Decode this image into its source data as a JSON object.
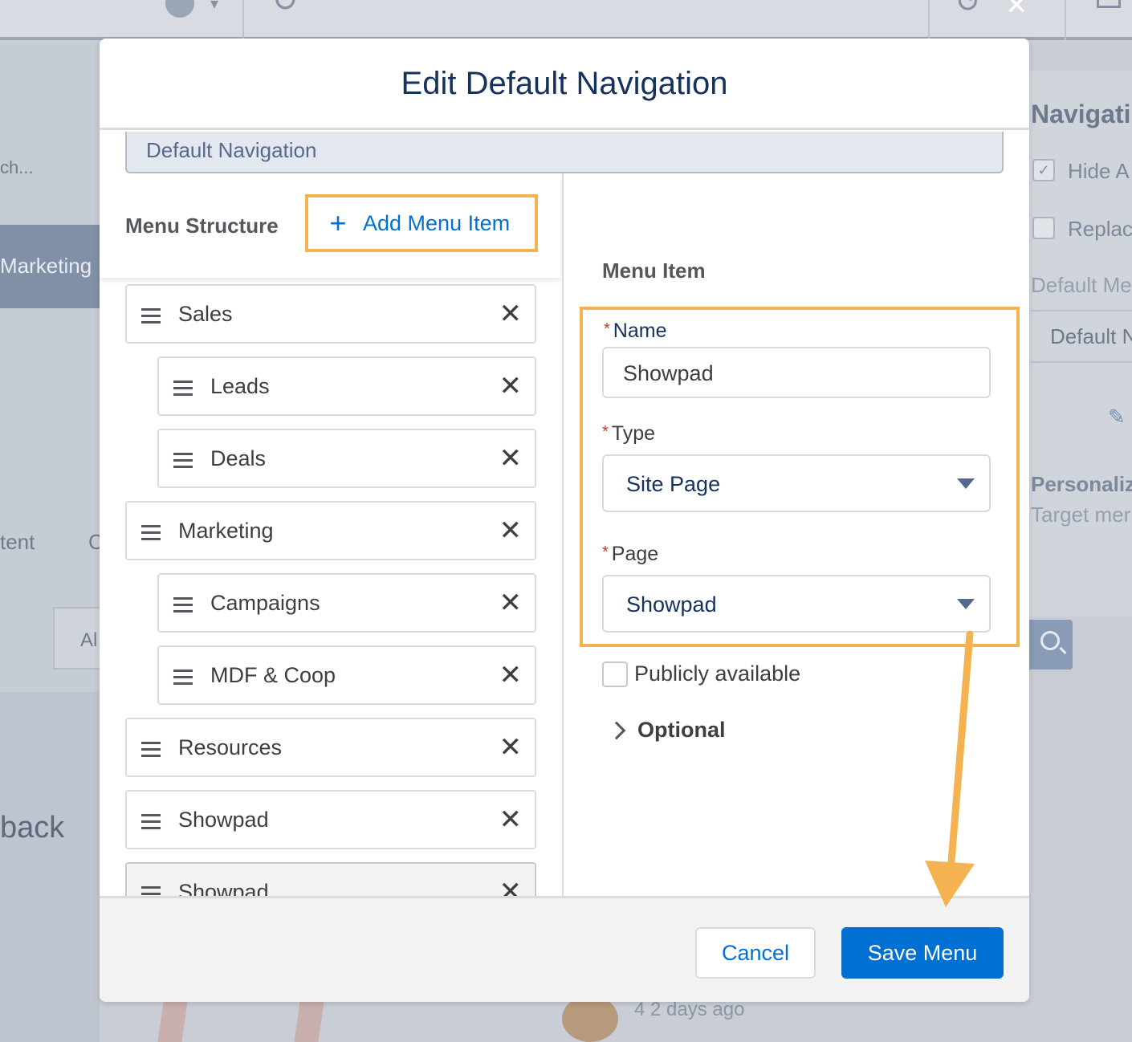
{
  "background": {
    "left_search_text": "ch...",
    "left_band_text": "Marketing",
    "left_tab_text_1": "tent",
    "left_tab_text_2": "C",
    "left_search_box_text": "Al",
    "left_back_text": "back",
    "right_title": "Navigati",
    "right_option_1": "Hide A",
    "right_option_2": "Replac",
    "right_default_menu_label": "Default Me",
    "right_default_value": "Default N",
    "right_personalize": "Personaliz",
    "right_target": "Target mer",
    "bottom_timestamp": "4 2 days ago"
  },
  "modal": {
    "title": "Edit Default Navigation",
    "navigation_name": "Default Navigation",
    "menu_structure_label": "Menu Structure",
    "add_menu_item_label": "Add Menu Item",
    "menu_items": [
      {
        "label": "Sales",
        "level": 0
      },
      {
        "label": "Leads",
        "level": 1
      },
      {
        "label": "Deals",
        "level": 1
      },
      {
        "label": "Marketing",
        "level": 0
      },
      {
        "label": "Campaigns",
        "level": 1
      },
      {
        "label": "MDF & Coop",
        "level": 1
      },
      {
        "label": "Resources",
        "level": 0
      },
      {
        "label": "Showpad",
        "level": 0
      },
      {
        "label": "Showpad",
        "level": 0,
        "selected": true
      }
    ],
    "menu_item_heading": "Menu Item",
    "form": {
      "name_label": "Name",
      "name_value": "Showpad",
      "type_label": "Type",
      "type_value": "Site Page",
      "page_label": "Page",
      "page_value": "Showpad",
      "required_marker": "*",
      "publicly_available_label": "Publicly available",
      "publicly_available_checked": false,
      "optional_label": "Optional"
    },
    "footer": {
      "cancel_label": "Cancel",
      "save_label": "Save Menu"
    }
  },
  "colors": {
    "brand_blue": "#0070d2",
    "highlight_orange": "#f4b350",
    "title_navy": "#16325c",
    "required_red": "#c23934"
  },
  "icons": {
    "close": "close-icon",
    "add": "plus-icon",
    "drag": "drag-handle-icon",
    "remove": "remove-x-icon",
    "dropdown": "caret-down-icon",
    "expand": "chevron-right-icon"
  }
}
